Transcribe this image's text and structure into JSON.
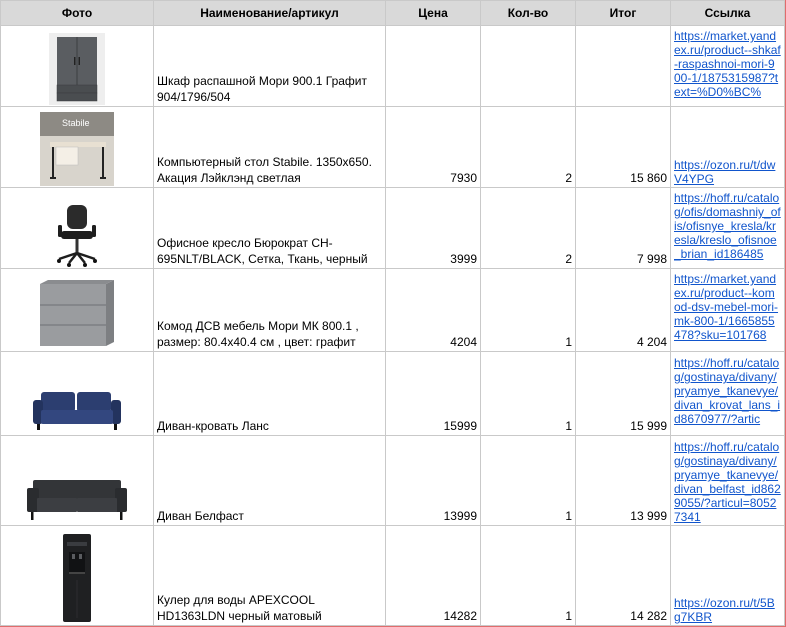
{
  "headers": {
    "photo": "Фото",
    "name": "Наименование/артикул",
    "price": "Цена",
    "qty": "Кол-во",
    "total": "Итог",
    "link": "Ссылка"
  },
  "rows": [
    {
      "image": "wardrobe-image",
      "name": "Шкаф распашной Мори 900.1 Графит 904/1796/504",
      "price": "",
      "qty": "",
      "total": "",
      "link": "https://market.yandex.ru/product--shkaf-raspashnoi-mori-900-1/1875315987?text=%D0%BC%"
    },
    {
      "image": "desk-image",
      "name": "Компьютерный стол Stabile. 1350х650. Акация Лэйклэнд светлая",
      "price": "7930",
      "qty": "2",
      "total": "15 860",
      "link": "https://ozon.ru/t/dwV4YPG"
    },
    {
      "image": "office-chair-image",
      "name": "Офисное кресло Бюрократ CH-695NLT/BLACK, Сетка, Ткань, черный",
      "price": "3999",
      "qty": "2",
      "total": "7 998",
      "link": "https://hoff.ru/catalog/ofis/domashniy_ofis/ofisnye_kresla/kresla/kreslo_ofisnoe_brian_id186485"
    },
    {
      "image": "dresser-image",
      "name": "Комод ДСВ мебель Мори МК 800.1 , размер: 80.4х40.4 см , цвет: графит",
      "price": "4204",
      "qty": "1",
      "total": "4 204",
      "link": "https://market.yandex.ru/product--komod-dsv-mebel-mori-mk-800-1/1665855478?sku=101768"
    },
    {
      "image": "sofa-bed-image",
      "name": "Диван-кровать Ланс",
      "price": "15999",
      "qty": "1",
      "total": "15 999",
      "link": "https://hoff.ru/catalog/gostinaya/divany/pryamye_tkanevye/divan_krovat_lans_id8670977/?artic"
    },
    {
      "image": "sofa-image",
      "name": "Диван Белфаст",
      "price": "13999",
      "qty": "1",
      "total": "13 999",
      "link": "https://hoff.ru/catalog/gostinaya/divany/pryamye_tkanevye/divan_belfast_id8629055/?articul=80527341"
    },
    {
      "image": "water-cooler-image",
      "name": "Кулер для воды APEXCOOL HD1363LDN черный матовый",
      "price": "14282",
      "qty": "1",
      "total": "14 282",
      "link": "https://ozon.ru/t/5Bg7KBR"
    }
  ],
  "desk_image_text": {
    "brand": "Stabile"
  }
}
